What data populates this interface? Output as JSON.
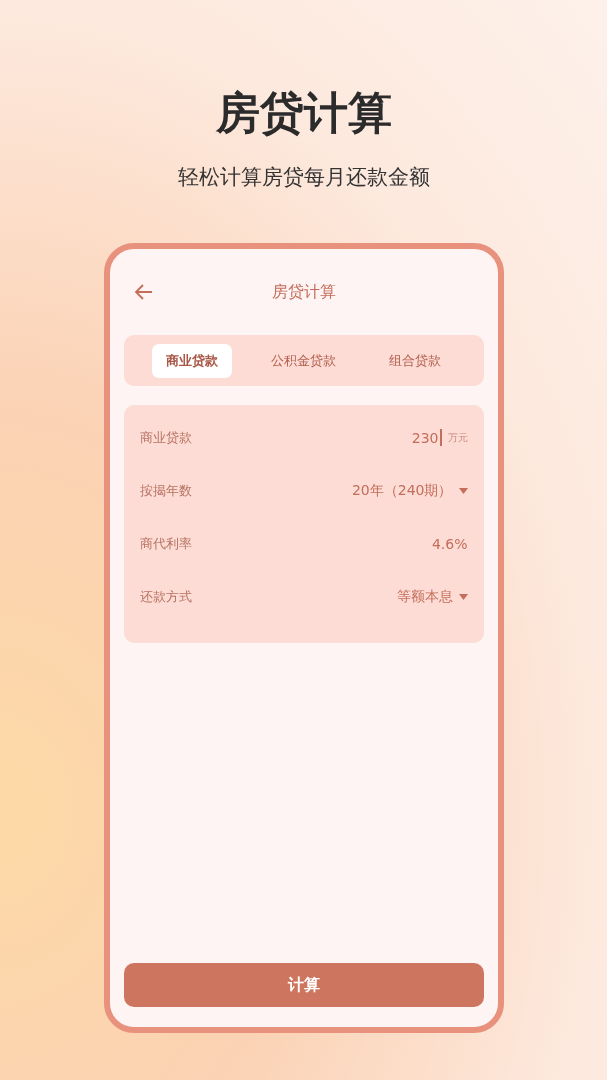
{
  "headline": "房贷计算",
  "subtitle": "轻松计算房贷每月还款金额",
  "screen": {
    "title": "房贷计算",
    "tabs": [
      {
        "label": "商业贷款",
        "selected": true
      },
      {
        "label": "公积金贷款",
        "selected": false
      },
      {
        "label": "组合贷款",
        "selected": false
      }
    ],
    "fields": [
      {
        "label": "商业贷款",
        "kind": "input",
        "value": "230",
        "unit": "万元"
      },
      {
        "label": "按揭年数",
        "kind": "select",
        "value": "20年（240期）"
      },
      {
        "label": "商代利率",
        "kind": "text",
        "value": "4.6%"
      },
      {
        "label": "还款方式",
        "kind": "select",
        "value": "等额本息"
      }
    ],
    "button": "计算"
  }
}
